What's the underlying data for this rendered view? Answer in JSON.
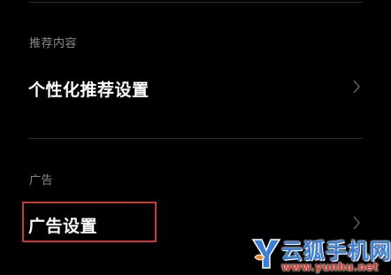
{
  "sections": {
    "recommended": {
      "header": "推荐内容",
      "item_label": "个性化推荐设置"
    },
    "ads": {
      "header": "广告",
      "item_label": "广告设置"
    }
  },
  "icons": {
    "row_chevron": "chevron-right-icon",
    "watermark_logo": "yunhu-logo-icon"
  },
  "watermark": {
    "brand": "云狐手机网",
    "url": "www.yunhu.net"
  },
  "colors": {
    "background": "#000000",
    "text_primary": "#ffffff",
    "text_secondary": "#8a8a8a",
    "highlight": "#c8393e",
    "divider": "#2e2e2e",
    "watermark_blue": "#3a7fd5",
    "watermark_red": "#d33a2c"
  }
}
